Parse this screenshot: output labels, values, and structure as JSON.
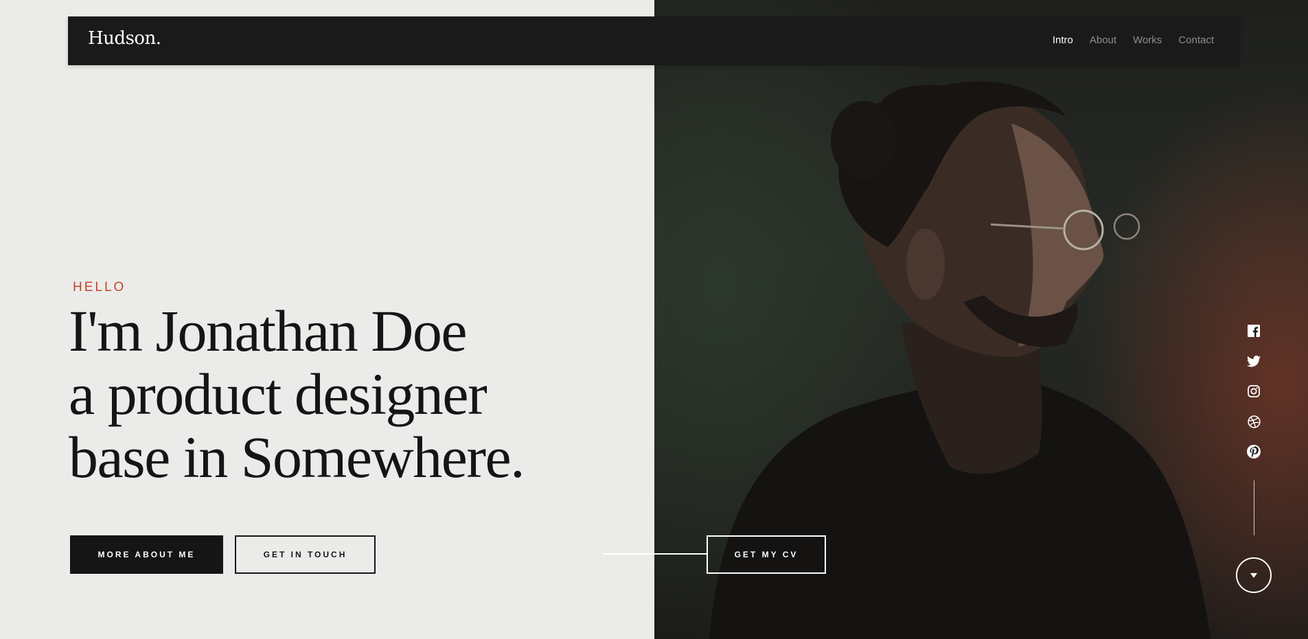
{
  "brand": {
    "logo": "Hudson."
  },
  "nav": {
    "items": [
      {
        "label": "Intro",
        "active": true
      },
      {
        "label": "About",
        "active": false
      },
      {
        "label": "Works",
        "active": false
      },
      {
        "label": "Contact",
        "active": false
      }
    ]
  },
  "hero": {
    "eyebrow": "HELLO",
    "headline_lines": [
      "I'm Jonathan Doe",
      "a product designer",
      "base in Somewhere."
    ],
    "buttons": {
      "more_about": "MORE ABOUT ME",
      "get_in_touch": "GET IN TOUCH",
      "get_cv": "GET MY CV"
    }
  },
  "social": {
    "icons": [
      "facebook-icon",
      "twitter-icon",
      "instagram-icon",
      "dribbble-icon",
      "pinterest-icon"
    ]
  },
  "scroll": {
    "icon": "chevron-down-icon"
  },
  "colors": {
    "accent": "#c4432a",
    "dark": "#151515",
    "light_bg": "#ebece9",
    "nav_bg": "#1a1a1a"
  }
}
